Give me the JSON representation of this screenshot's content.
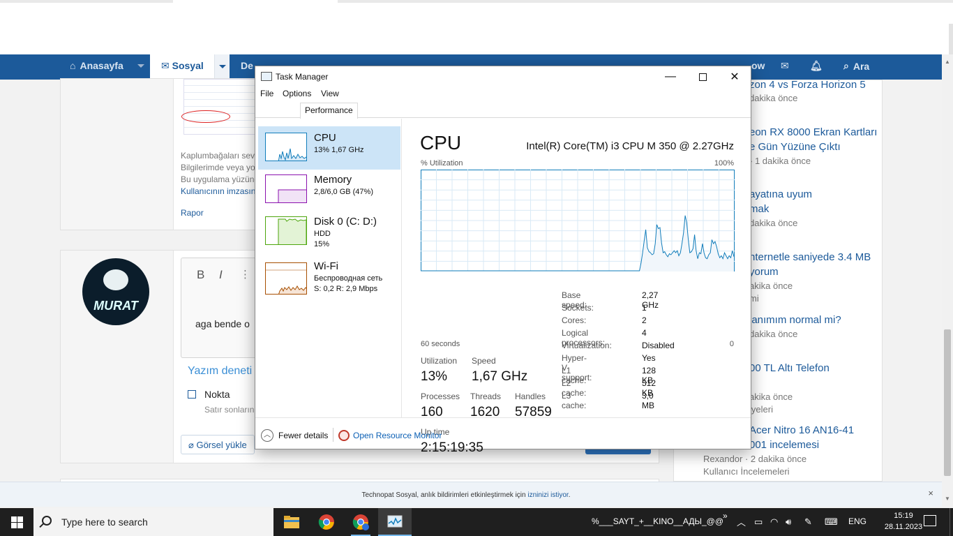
{
  "site": {
    "nav": {
      "home": "Anasayfa",
      "social": "Sosyal",
      "partial_next": "De",
      "partial_right": "ow",
      "search": "Ara"
    },
    "post1": {
      "lines": [
        "Kaplumbağaları seve",
        "Bilgilerimde veya yo",
        "Bu uygulama yüzünd",
        "Kullanıcının imzasın"
      ],
      "report": "Rapor"
    },
    "editor": {
      "bold": "B",
      "italic": "I",
      "text": "aga bende o",
      "spellcheck": "Yazım deneti",
      "option": "Nokta",
      "option_sub": "Satır sonların",
      "upload": "Görsel yükle"
    },
    "avatar_text": "MURAT",
    "sidebar": [
      {
        "title": [
          "zon 4 vs Forza Horizon 5"
        ],
        "meta": [
          "dakika önce"
        ]
      },
      {
        "title": [
          "eon RX 8000 Ekran Kartları",
          "e Gün Yüzüne Çıktı"
        ],
        "meta": [
          "› 1 dakika önce"
        ]
      },
      {
        "title": [
          "ayatına uyum",
          "mak"
        ],
        "meta": [
          "dakika önce"
        ]
      },
      {
        "title": [
          "nternetle saniyede 3.4 MB",
          "yorum"
        ],
        "meta": [
          "akika önce",
          "mi"
        ]
      },
      {
        "title": [
          "lanımım normal mi?"
        ],
        "meta": [
          "dakika önce"
        ]
      },
      {
        "title": [
          "00 TL Altı Telefon"
        ],
        "meta": [
          "akika önce",
          "iyeleri"
        ]
      },
      {
        "title": [
          "Acer Nitro 16 AN16-41",
          "001 incelemesi"
        ],
        "meta": [
          "Rexandor · 2 dakika önce",
          "Kullanıcı İncelemeleri"
        ]
      }
    ],
    "notification": {
      "prefix": "Technopat Sosyal, anlık bildirimleri etkinleştirmek için ",
      "link": "izninizi istiyor",
      "suffix": ".",
      "close": "×"
    }
  },
  "taskmgr": {
    "title": "Task Manager",
    "menu": [
      "File",
      "Options",
      "View"
    ],
    "tab": "Performance",
    "resources": [
      {
        "name": "CPU",
        "line1": "13%  1,67 GHz",
        "line2": ""
      },
      {
        "name": "Memory",
        "line1": "2,8/6,0 GB (47%)",
        "line2": ""
      },
      {
        "name": "Disk 0 (C: D:)",
        "line1": "HDD",
        "line2": "15%"
      },
      {
        "name": "Wi-Fi",
        "line1": "Беспроводная сеть",
        "line2": "S: 0,2  R: 2,9 Mbps"
      }
    ],
    "cpu": {
      "heading": "CPU",
      "model": "Intel(R) Core(TM) i3 CPU M 350 @ 2.27GHz",
      "graph_label": "% Utilization",
      "graph_max": "100%",
      "graph_time": "60 seconds",
      "graph_min": "0",
      "utilization_history": [
        0,
        0,
        0,
        0,
        0,
        0,
        0,
        0,
        0,
        0,
        0,
        0,
        0,
        0,
        0,
        0,
        0,
        0,
        0,
        0,
        0,
        0,
        0,
        0,
        0,
        0,
        0,
        0,
        0,
        0,
        0,
        0,
        0,
        0,
        0,
        0,
        0,
        0,
        0,
        0,
        0,
        0,
        0,
        0,
        0,
        0,
        0,
        0,
        0,
        0,
        0,
        0,
        0,
        0,
        0,
        0,
        0,
        0,
        0,
        0,
        0,
        0,
        0,
        0,
        0,
        0,
        0,
        0,
        0,
        0,
        0,
        0,
        0,
        0,
        0,
        0,
        0,
        0,
        0,
        0,
        0,
        0,
        0,
        0,
        0,
        0,
        0,
        0,
        0,
        0,
        0,
        0,
        0,
        0,
        0,
        0,
        0,
        0,
        0,
        0,
        0,
        0,
        0,
        0,
        0,
        0,
        0,
        0,
        0,
        0,
        0,
        0,
        0,
        0,
        0,
        0,
        0,
        0,
        0,
        0,
        0,
        0,
        0,
        0,
        0,
        0,
        0,
        0,
        0,
        0,
        0,
        0,
        0,
        0,
        0,
        0,
        0,
        0,
        0,
        0,
        8,
        18,
        30,
        41,
        23,
        19,
        18,
        16,
        17,
        27,
        46,
        42,
        43,
        28,
        18,
        19,
        16,
        14,
        17,
        16,
        18,
        20,
        18,
        20,
        15,
        18,
        27,
        38,
        55,
        48,
        31,
        18,
        19,
        22,
        36,
        20,
        12,
        18,
        17,
        27,
        18,
        13,
        12,
        16,
        18,
        31,
        27,
        29,
        24,
        17,
        13,
        15,
        12,
        18,
        15,
        12,
        15,
        13,
        20,
        14
      ],
      "stats": {
        "utilization_label": "Utilization",
        "utilization": "13%",
        "speed_label": "Speed",
        "speed": "1,67 GHz",
        "processes_label": "Processes",
        "processes": "160",
        "threads_label": "Threads",
        "threads": "1620",
        "handles_label": "Handles",
        "handles": "57859",
        "uptime_label": "Up time",
        "uptime": "2:15:19:35"
      },
      "specs": [
        {
          "k": "Base speed:",
          "v": "2,27 GHz"
        },
        {
          "k": "Sockets:",
          "v": "1"
        },
        {
          "k": "Cores:",
          "v": "2"
        },
        {
          "k": "Logical processors:",
          "v": "4"
        },
        {
          "k": "Virtualization:",
          "v": "Disabled"
        },
        {
          "k": "Hyper-V support:",
          "v": "Yes"
        },
        {
          "k": "L1 cache:",
          "v": "128 KB"
        },
        {
          "k": "L2 cache:",
          "v": "512 KB"
        },
        {
          "k": "L3 cache:",
          "v": "3,0 MB"
        }
      ]
    },
    "footer": {
      "fewer": "Fewer details",
      "resource_monitor": "Open Resource Monitor"
    },
    "colors": {
      "cpu": "#117dbb",
      "memory": "#8b12ae",
      "disk": "#4da60c",
      "wifi": "#a74f01",
      "selected": "#cce4f7"
    }
  },
  "taskbar": {
    "search_placeholder": "Type here to search",
    "tray_text": "%___SAYT_+__KINO__АДЫ_@@",
    "tray_more": "»",
    "language": "ENG",
    "time": "15:19",
    "date": "28.11.2023"
  }
}
